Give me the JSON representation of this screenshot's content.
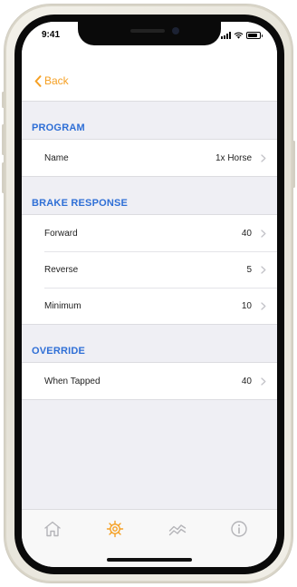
{
  "status_bar": {
    "time": "9:41",
    "signal_icon": "cellular-signal-icon",
    "wifi_icon": "wifi-icon",
    "battery_icon": "battery-icon",
    "battery_level": 0.85
  },
  "nav": {
    "back_label": "Back",
    "back_icon": "chevron-left-icon",
    "accent_color": "#f5a024"
  },
  "sections": [
    {
      "header": "PROGRAM",
      "rows": [
        {
          "label": "Name",
          "value": "1x Horse"
        }
      ]
    },
    {
      "header": "BRAKE RESPONSE",
      "rows": [
        {
          "label": "Forward",
          "value": "40"
        },
        {
          "label": "Reverse",
          "value": "5"
        },
        {
          "label": "Minimum",
          "value": "10"
        }
      ]
    },
    {
      "header": "OVERRIDE",
      "rows": [
        {
          "label": "When Tapped",
          "value": "40"
        }
      ]
    }
  ],
  "section_header_color": "#2f6fd6",
  "tab_bar": {
    "tabs": [
      {
        "icon": "home-icon",
        "active": false
      },
      {
        "icon": "gear-icon",
        "active": true
      },
      {
        "icon": "graph-icon",
        "active": false
      },
      {
        "icon": "info-icon",
        "active": false
      }
    ],
    "active_color": "#f5a024",
    "inactive_color": "#b4b4b8"
  }
}
